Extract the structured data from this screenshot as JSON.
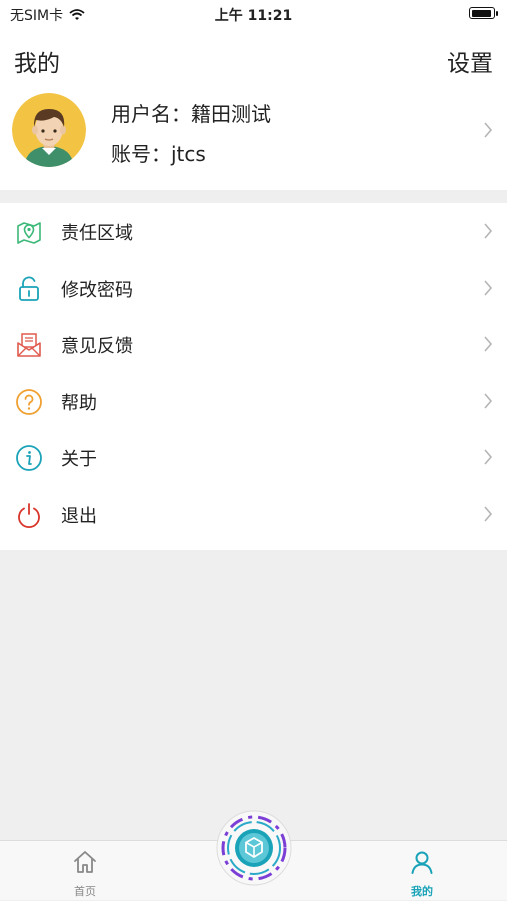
{
  "status_bar": {
    "carrier": "无SIM卡",
    "time": "上午 11:21"
  },
  "header": {
    "title": "我的",
    "settings_label": "设置"
  },
  "profile": {
    "name_text": "用户名：籍田测试",
    "account_text": "账号：jtcs"
  },
  "menu": {
    "items": [
      {
        "label": "责任区域",
        "icon": "map-icon",
        "color": "#3cb878"
      },
      {
        "label": "修改密码",
        "icon": "unlock-icon",
        "color": "#1aa3b8"
      },
      {
        "label": "意见反馈",
        "icon": "feedback-mail-icon",
        "color": "#e05a4e"
      },
      {
        "label": "帮助",
        "icon": "help-icon",
        "color": "#f0a030"
      },
      {
        "label": "关于",
        "icon": "info-icon",
        "color": "#1aa3b8"
      },
      {
        "label": "退出",
        "icon": "power-icon",
        "color": "#d9352b"
      }
    ]
  },
  "tabbar": {
    "tabs": [
      {
        "label": "首页",
        "icon": "home-icon",
        "active": false
      },
      {
        "label": "我的",
        "icon": "user-icon",
        "active": true
      }
    ],
    "center_button_icon": "cube-scan-icon"
  },
  "colors": {
    "accent": "#1aa3b8",
    "background": "#efefef"
  }
}
